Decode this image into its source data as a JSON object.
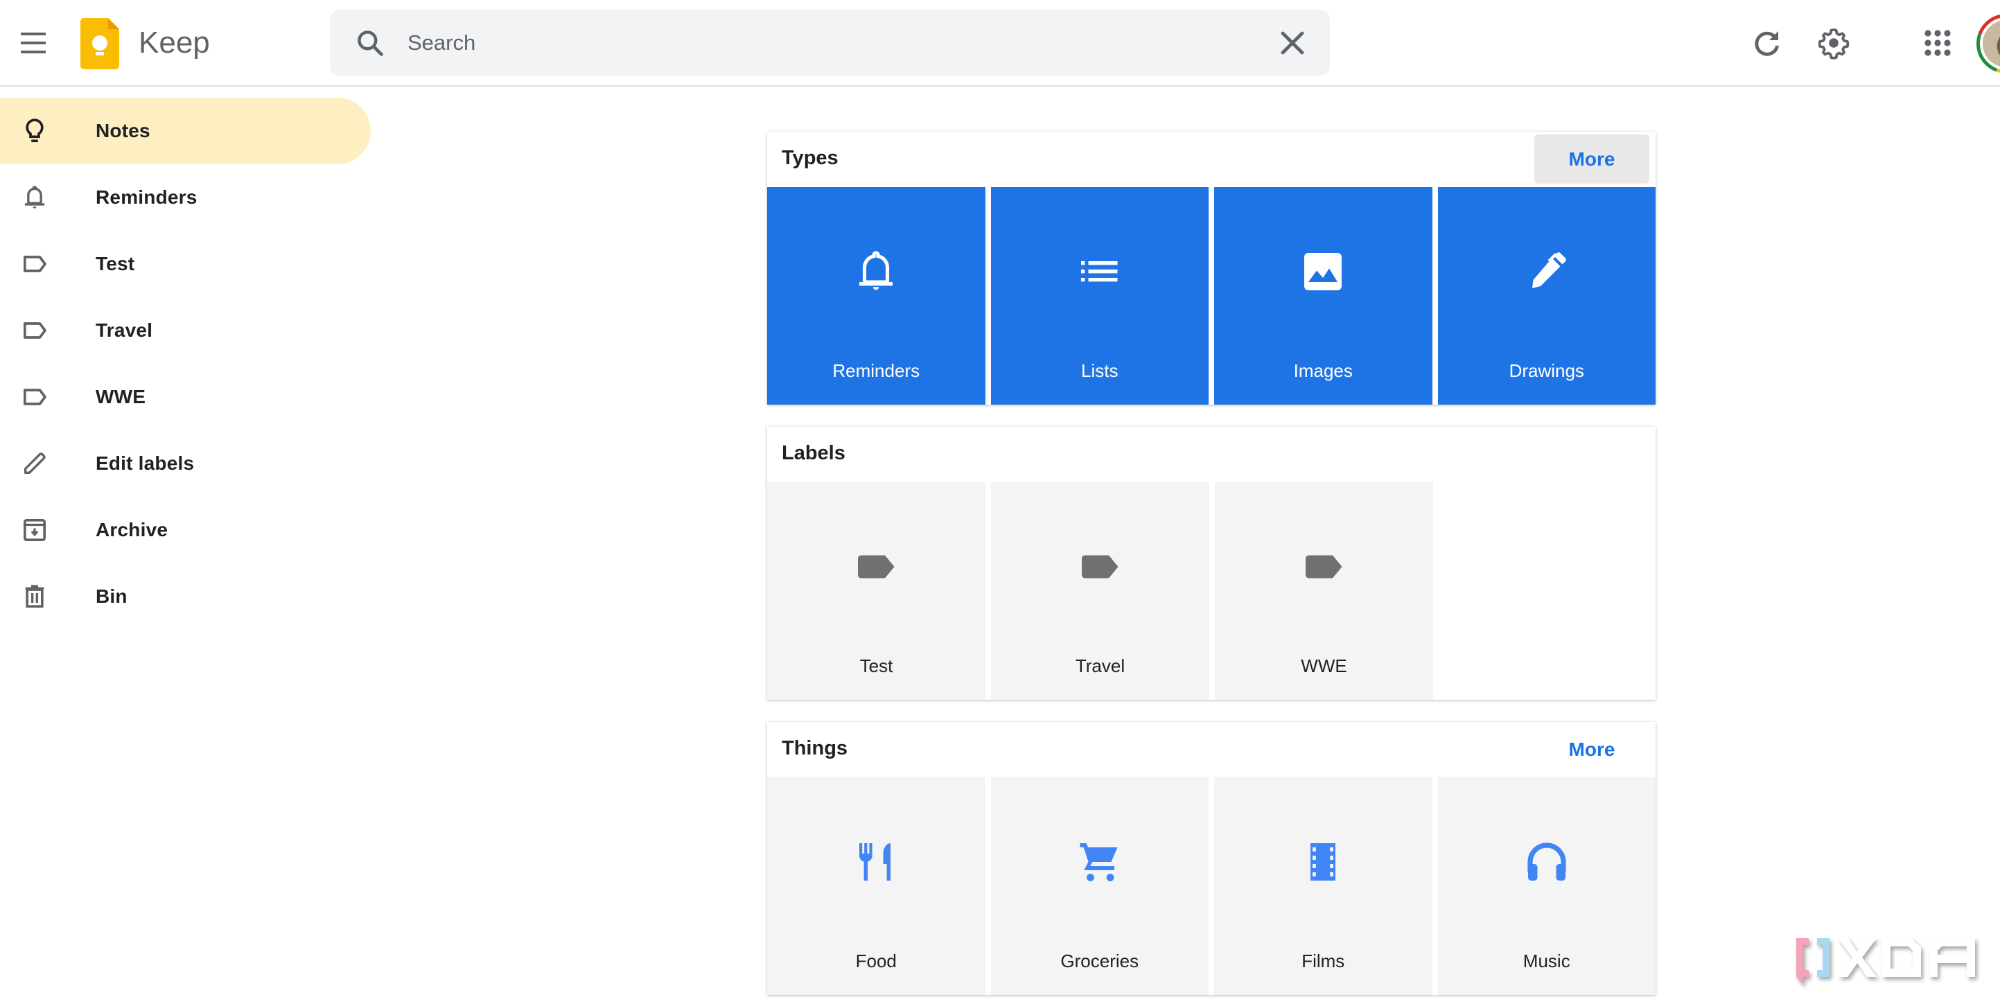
{
  "header": {
    "app_title": "Keep",
    "search": {
      "placeholder": "Search",
      "value": ""
    },
    "icons": [
      "menu-icon",
      "keep-logo",
      "search-icon",
      "clear-icon",
      "refresh-icon",
      "settings-icon",
      "apps-icon",
      "avatar"
    ]
  },
  "sidebar": {
    "items": [
      {
        "label": "Notes",
        "icon": "lightbulb-icon",
        "active": true
      },
      {
        "label": "Reminders",
        "icon": "bell-icon",
        "active": false
      },
      {
        "label": "Test",
        "icon": "label-icon",
        "active": false
      },
      {
        "label": "Travel",
        "icon": "label-icon",
        "active": false
      },
      {
        "label": "WWE",
        "icon": "label-icon",
        "active": false
      },
      {
        "label": "Edit labels",
        "icon": "pencil-icon",
        "active": false
      },
      {
        "label": "Archive",
        "icon": "archive-icon",
        "active": false
      },
      {
        "label": "Bin",
        "icon": "trash-icon",
        "active": false
      }
    ]
  },
  "panels": {
    "types": {
      "title": "Types",
      "more_label": "More",
      "tiles": [
        {
          "label": "Reminders",
          "icon": "bell-icon"
        },
        {
          "label": "Lists",
          "icon": "list-icon"
        },
        {
          "label": "Images",
          "icon": "image-icon"
        },
        {
          "label": "Drawings",
          "icon": "pen-icon"
        }
      ]
    },
    "labels": {
      "title": "Labels",
      "tiles": [
        {
          "label": "Test",
          "icon": "label-icon"
        },
        {
          "label": "Travel",
          "icon": "label-icon"
        },
        {
          "label": "WWE",
          "icon": "label-icon"
        }
      ]
    },
    "things": {
      "title": "Things",
      "more_label": "More",
      "tiles": [
        {
          "label": "Food",
          "icon": "restaurant-icon"
        },
        {
          "label": "Groceries",
          "icon": "cart-icon"
        },
        {
          "label": "Films",
          "icon": "film-icon"
        },
        {
          "label": "Music",
          "icon": "headphones-icon"
        }
      ]
    }
  },
  "watermark": {
    "text": "XDA"
  },
  "colors": {
    "accent": "#1a73e8",
    "types_tile": "#1e74e4",
    "active_nav": "#feefc3",
    "keep_yellow": "#fbbc04"
  }
}
